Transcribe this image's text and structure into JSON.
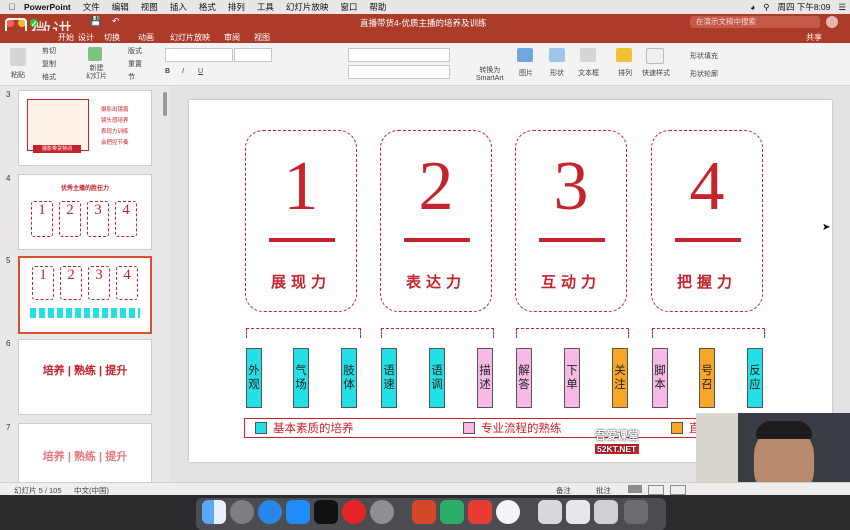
{
  "menubar": {
    "app_name": "PowerPoint",
    "items": [
      "文件",
      "编辑",
      "视图",
      "插入",
      "格式",
      "排列",
      "工具",
      "幻灯片放映",
      "窗口",
      "帮助"
    ],
    "datetime": "周四 下午8:09"
  },
  "titlebar": {
    "document_title": "直播带货4-优质主播的培养及训练",
    "search_placeholder": "在演示文稿中搜索"
  },
  "ribbon": {
    "tabs": [
      "开始",
      "设计",
      "切换",
      "动画",
      "幻灯片放映",
      "审阅",
      "视图"
    ],
    "share_label": "共享",
    "paste_label": "粘贴",
    "cut_label": "剪切",
    "copy_label": "复制",
    "format_painter_label": "格式",
    "new_slide_label": "新建\n幻灯片",
    "layout_label": "版式",
    "reset_label": "重置",
    "section_label": "节",
    "smartart_label": "转换为\nSmartArt",
    "picture_label": "图片",
    "shape_label": "形状",
    "textbox_label": "文本框",
    "arrange_label": "排列",
    "quick_styles_label": "快速样式",
    "shape_fill_label": "形状填充",
    "shape_outline_label": "形状轮廓"
  },
  "watermark": {
    "text": "微讲"
  },
  "thumbnails": [
    {
      "num": "3",
      "lines": [
        "摄影出镜篇",
        "镜头感培养",
        "表现力训练",
        "会把控节奏"
      ],
      "caption": "摄影带货特训"
    },
    {
      "num": "4",
      "title": "优秀主播的胜任力",
      "digits": [
        "1",
        "2",
        "3",
        "4"
      ]
    },
    {
      "num": "5",
      "digits": [
        "1",
        "2",
        "3",
        "4"
      ]
    },
    {
      "num": "6",
      "words": [
        "培养",
        "熟练",
        "提升"
      ]
    },
    {
      "num": "7",
      "words": [
        "培养",
        "熟练",
        "提升"
      ]
    }
  ],
  "slide": {
    "cards": [
      {
        "num": "1",
        "label": "展现力"
      },
      {
        "num": "2",
        "label": "表达力"
      },
      {
        "num": "3",
        "label": "互动力"
      },
      {
        "num": "4",
        "label": "把握力"
      }
    ],
    "skills": [
      {
        "text": "外观",
        "color": "cyan"
      },
      {
        "text": "气场",
        "color": "cyan"
      },
      {
        "text": "肢体",
        "color": "cyan"
      },
      {
        "text": "语速",
        "color": "cyan"
      },
      {
        "text": "语调",
        "color": "cyan"
      },
      {
        "text": "描述",
        "color": "pink"
      },
      {
        "text": "解答",
        "color": "pink"
      },
      {
        "text": "下单",
        "color": "pink"
      },
      {
        "text": "关注",
        "color": "orange"
      },
      {
        "text": "脚本",
        "color": "pink"
      },
      {
        "text": "号召",
        "color": "orange"
      },
      {
        "text": "反应",
        "color": "cyan"
      }
    ],
    "legend": [
      {
        "text": "基本素质的培养",
        "color": "#22e0e6"
      },
      {
        "text": "专业流程的熟练",
        "color": "#f7b9e6"
      },
      {
        "text": "直播圈",
        "color": "#f7a628"
      }
    ]
  },
  "overlay_watermark": {
    "line1": "吾爱课堂",
    "line2": "52KT.NET"
  },
  "statusbar": {
    "slide_counter": "幻灯片 5 / 105",
    "language": "中文(中国)",
    "notes_label": "备注",
    "comments_label": "批注"
  },
  "colors": {
    "accent": "#c7232c",
    "cyan": "#22e0e6",
    "pink": "#f7b9e6",
    "orange": "#f7a628",
    "titlebar": "#ac3b2a"
  }
}
